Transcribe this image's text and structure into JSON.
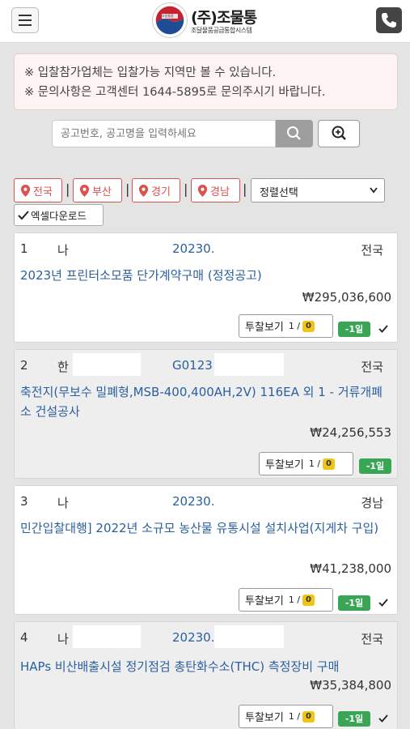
{
  "header": {
    "logo_title": "(주)조물통",
    "logo_subtitle": "조달물품공급통합시스템",
    "logo_seal_text": "조달물품"
  },
  "notice": {
    "line1": "※ 입찰참가업체는 입찰가능 지역만 볼 수 있습니다.",
    "line2": "※ 문의사항은 고객센터 1644-5895로 문의주시기 바랍니다."
  },
  "search": {
    "placeholder": "공고번호, 공고명을 입력하세요"
  },
  "filters": {
    "regions": [
      "전국",
      "부산",
      "경기",
      "경남"
    ],
    "sort_label": "정렬선택",
    "excel_label": "엑셀다운로드"
  },
  "colors": {
    "accent_blue": "#2a5fa0",
    "region_red": "#d9534f",
    "day_badge_green": "#3aa655",
    "count_badge_yellow": "#f0c419"
  },
  "listings": [
    {
      "num": "1",
      "org": "나",
      "code": "20230.",
      "region": "전국",
      "title": "2023년 프린터소모품 단가계약구매 (정정공고)",
      "amount": "₩295,036,600",
      "bid_label": "투찰보기",
      "bid_count": "1 /",
      "bid_badge": "0",
      "day_badge": "-1일"
    },
    {
      "num": "2",
      "org": "한",
      "code": "G0123",
      "region": "전국",
      "title": "축전지(무보수 밀폐형,MSB-400,400AH,2V) 116EA 외 1 - 거류개폐소 건설공사",
      "amount": "₩24,256,553",
      "bid_label": "투찰보기",
      "bid_count": "1 /",
      "bid_badge": "0",
      "day_badge": "-1일"
    },
    {
      "num": "3",
      "org": "나",
      "code": "20230.",
      "region": "경남",
      "title": "민간입찰대행] 2022년 소규모 농산물 유통시설 설치사업(지게차 구입)",
      "amount": "₩41,238,000",
      "bid_label": "투찰보기",
      "bid_count": "1 /",
      "bid_badge": "0",
      "day_badge": "-1일"
    },
    {
      "num": "4",
      "org": "나",
      "code": "20230.",
      "region": "전국",
      "title": "HAPs 비산배출시설 정기점검 총탄화수소(THC) 측정장비 구매",
      "amount": "₩35,384,800",
      "bid_label": "투찰보기",
      "bid_count": "1 /",
      "bid_badge": "0",
      "day_badge": "-1일"
    }
  ]
}
